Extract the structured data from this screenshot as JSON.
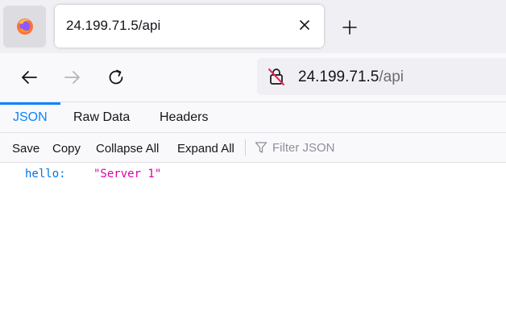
{
  "tab": {
    "title": "24.199.71.5/api",
    "icon": "firefox-icon"
  },
  "navbar": {
    "url_host": "24.199.71.5",
    "url_path": "/api"
  },
  "viewer_tabs": [
    {
      "label": "JSON",
      "active": true
    },
    {
      "label": "Raw Data",
      "active": false
    },
    {
      "label": "Headers",
      "active": false
    }
  ],
  "toolbar": {
    "save": "Save",
    "copy": "Copy",
    "collapse_all": "Collapse All",
    "expand_all": "Expand All",
    "filter_placeholder": "Filter JSON"
  },
  "json": {
    "rows": [
      {
        "key": "hello:",
        "value": "\"Server 1\""
      }
    ]
  },
  "colors": {
    "accent": "#0a84ff",
    "json_key": "#0074e8",
    "json_string": "#dd00a9",
    "insecure_red": "#e22850"
  }
}
